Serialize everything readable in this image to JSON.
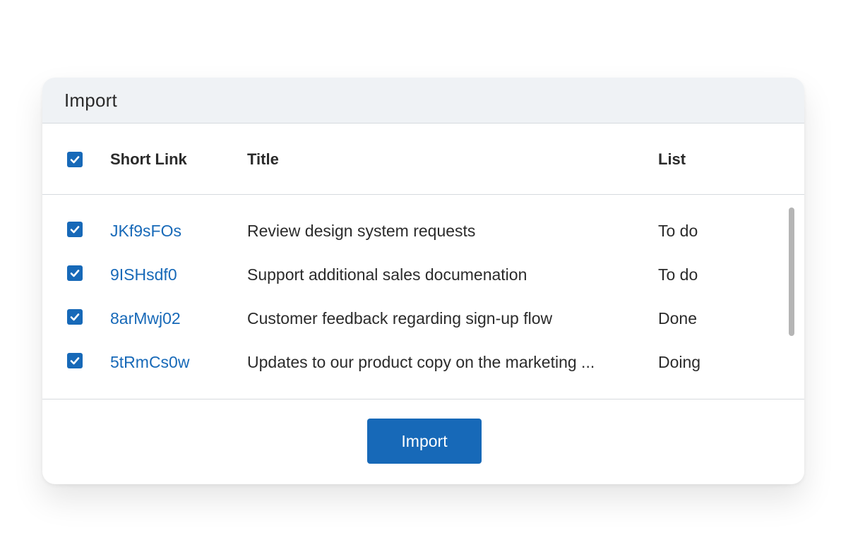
{
  "dialog": {
    "title": "Import"
  },
  "table": {
    "columns": {
      "short_link": "Short Link",
      "title": "Title",
      "list": "List"
    },
    "select_all_checked": true,
    "rows": [
      {
        "checked": true,
        "short_link": "JKf9sFOs",
        "title": "Review design system requests",
        "list": "To do"
      },
      {
        "checked": true,
        "short_link": "9ISHsdf0",
        "title": "Support additional sales documenation",
        "list": "To do"
      },
      {
        "checked": true,
        "short_link": "8arMwj02",
        "title": "Customer feedback regarding sign-up flow",
        "list": "Done"
      },
      {
        "checked": true,
        "short_link": "5tRmCs0w",
        "title": "Updates to our product copy on the marketing ...",
        "list": "Doing"
      }
    ]
  },
  "footer": {
    "import_button_label": "Import"
  },
  "colors": {
    "accent": "#1769b8",
    "header_bg": "#eff2f5",
    "text": "#2b2b2b",
    "divider": "#d6dadf"
  },
  "icons": {
    "checkbox": "checkbox-checked-icon"
  }
}
